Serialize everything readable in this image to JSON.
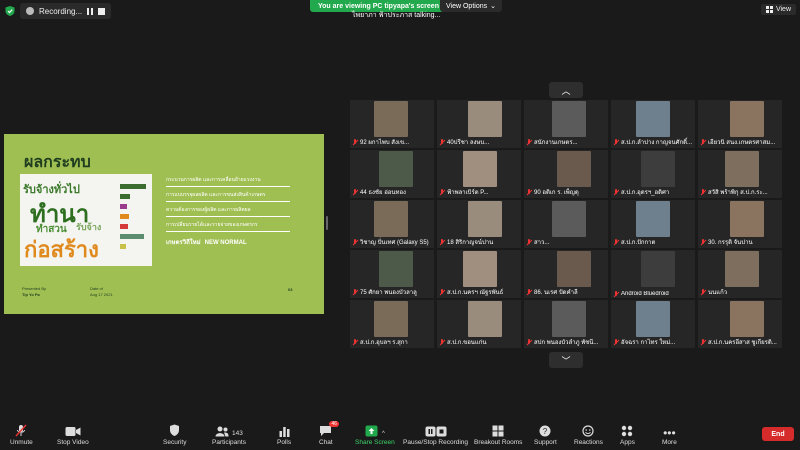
{
  "top_bar": {
    "recording_label": "Recording...",
    "share_banner": "You are viewing PC tipyapa's screen",
    "view_options": "View Options",
    "speaker_text": "ไพยาภา ฟ้าประภาส talking...",
    "view_label": "View"
  },
  "slide": {
    "title": "ผลกระทบ",
    "items": [
      "กระบวนการผลิต และการเคลื่อนย้ายแรงงาน",
      "การแบบรรจุผลผลิต และการขนส่งสินค้าเกษตร",
      "ความต้องการของผู้ผลิต และการผลิตผล",
      "การเปลี่ยนรายได้และรายจ่ายของเกษตรกร"
    ],
    "highlight_prefix": "เกษตรวิถีใหม่",
    "highlight": "NEW NORMAL",
    "wordcloud_words": [
      "รับจ้างทั่วไป",
      "ทำนา",
      "ทำสวน",
      "รับจ้าง",
      "ก่อสร้าง"
    ],
    "footer": {
      "presented_label": "Presented By",
      "presented_by": "Tip Yo Pa",
      "date_label": "Date of",
      "date": "Aug 17 2021",
      "page": "03"
    },
    "colors": {
      "bg": "#a0bf52",
      "title": "#1f3d1f"
    }
  },
  "participants": [
    {
      "name": "92 ผกาไพบ สังเข..."
    },
    {
      "name": "40ปรีชา ลงษบ..."
    },
    {
      "name": "สนักงานเกษตร..."
    },
    {
      "name": "ส.ป.ก.ลำปาง กาญจนศักดิ์..."
    },
    {
      "name": "เอียวนิ สนง.เกษตรศาสม..."
    },
    {
      "name": "44 ธงชัย อ่อนทอง"
    },
    {
      "name": "ฟ้าพลาเบิร์ด P..."
    },
    {
      "name": "90 อติเก ร. เพ็ญดุ"
    },
    {
      "name": "ส.ป.ก.อุดรฯ_อดิศา"
    },
    {
      "name": "สวัสิ พร้าพิกุ ส.ป.ก.ระ..."
    },
    {
      "name": "วิชาญ ปั่นเทศ (Galaxy S5)"
    },
    {
      "name": "18 สิริกาญจน์ปาน"
    },
    {
      "name": "สาว..."
    },
    {
      "name": "ส.ป.ก.ปักกาต"
    },
    {
      "name": "30. กรรุติ จันปาน"
    },
    {
      "name": "75 ศักยา พนองบัวลาลู"
    },
    {
      "name": "ส.ป.ก.นครฯ ณัฐรพันธ์"
    },
    {
      "name": "86. นเรศ ปัดคำลี"
    },
    {
      "name": "Android Bluedroid"
    },
    {
      "name": "นนแก้ว"
    },
    {
      "name": "ส.ป.ก.อุบลฯ ร.สุกา"
    },
    {
      "name": "ส.ป.ก.ขอนแก่น"
    },
    {
      "name": "สปก พนองบัวลำภู พัชนี..."
    },
    {
      "name": "อัจฉรา กาไทร ใหม่..."
    },
    {
      "name": "ส.ป.ก.นครอีสาส ชูเกียรติ..."
    }
  ],
  "toolbar": {
    "unmute": "Unmute",
    "stop_video": "Stop Video",
    "security": "Security",
    "participants": "Participants",
    "participants_count": "143",
    "polls": "Polls",
    "chat": "Chat",
    "chat_badge": "46",
    "share_screen": "Share Screen",
    "pause_recording": "Pause/Stop Recording",
    "breakout": "Breakout Rooms",
    "support": "Support",
    "reactions": "Reactions",
    "apps": "Apps",
    "more": "More",
    "end": "End"
  }
}
